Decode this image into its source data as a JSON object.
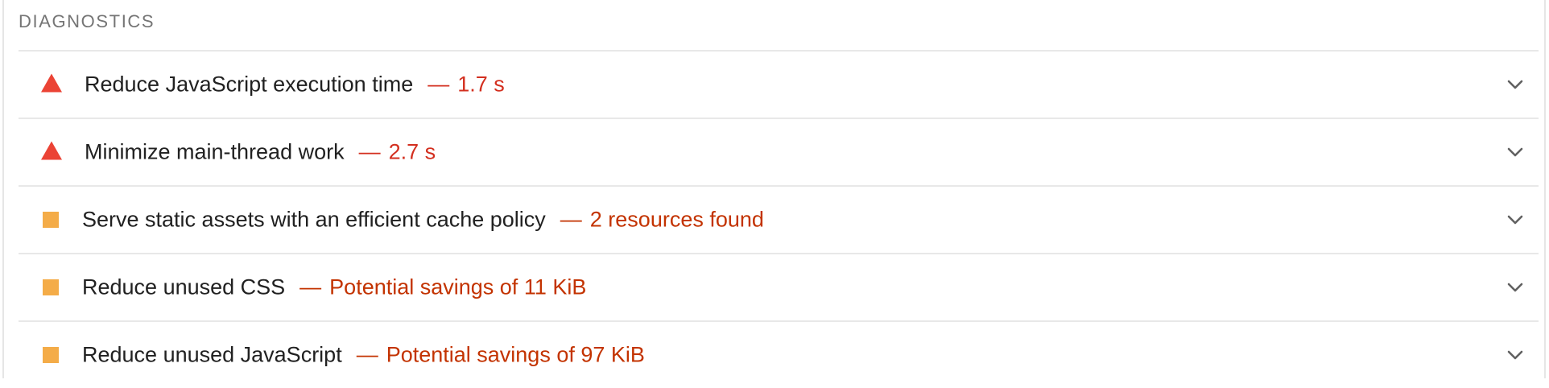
{
  "section": {
    "title": "DIAGNOSTICS"
  },
  "audits": [
    {
      "status": "fail",
      "icon": "red-triangle-icon",
      "title": "Reduce JavaScript execution time",
      "separator": "—",
      "display_value": "1.7 s"
    },
    {
      "status": "fail",
      "icon": "red-triangle-icon",
      "title": "Minimize main-thread work",
      "separator": "—",
      "display_value": "2.7 s"
    },
    {
      "status": "average",
      "icon": "orange-square-icon",
      "title": "Serve static assets with an efficient cache policy",
      "separator": "—",
      "display_value": "2 resources found"
    },
    {
      "status": "average",
      "icon": "orange-square-icon",
      "title": "Reduce unused CSS",
      "separator": "—",
      "display_value": "Potential savings of 11 KiB"
    },
    {
      "status": "average",
      "icon": "orange-square-icon",
      "title": "Reduce unused JavaScript",
      "separator": "—",
      "display_value": "Potential savings of 97 KiB"
    }
  ],
  "colors": {
    "fail": "#eb4335",
    "fail_text": "#d32f1f",
    "average": "#f4ac48",
    "average_text": "#c33300",
    "divider": "#e8e8e8"
  }
}
